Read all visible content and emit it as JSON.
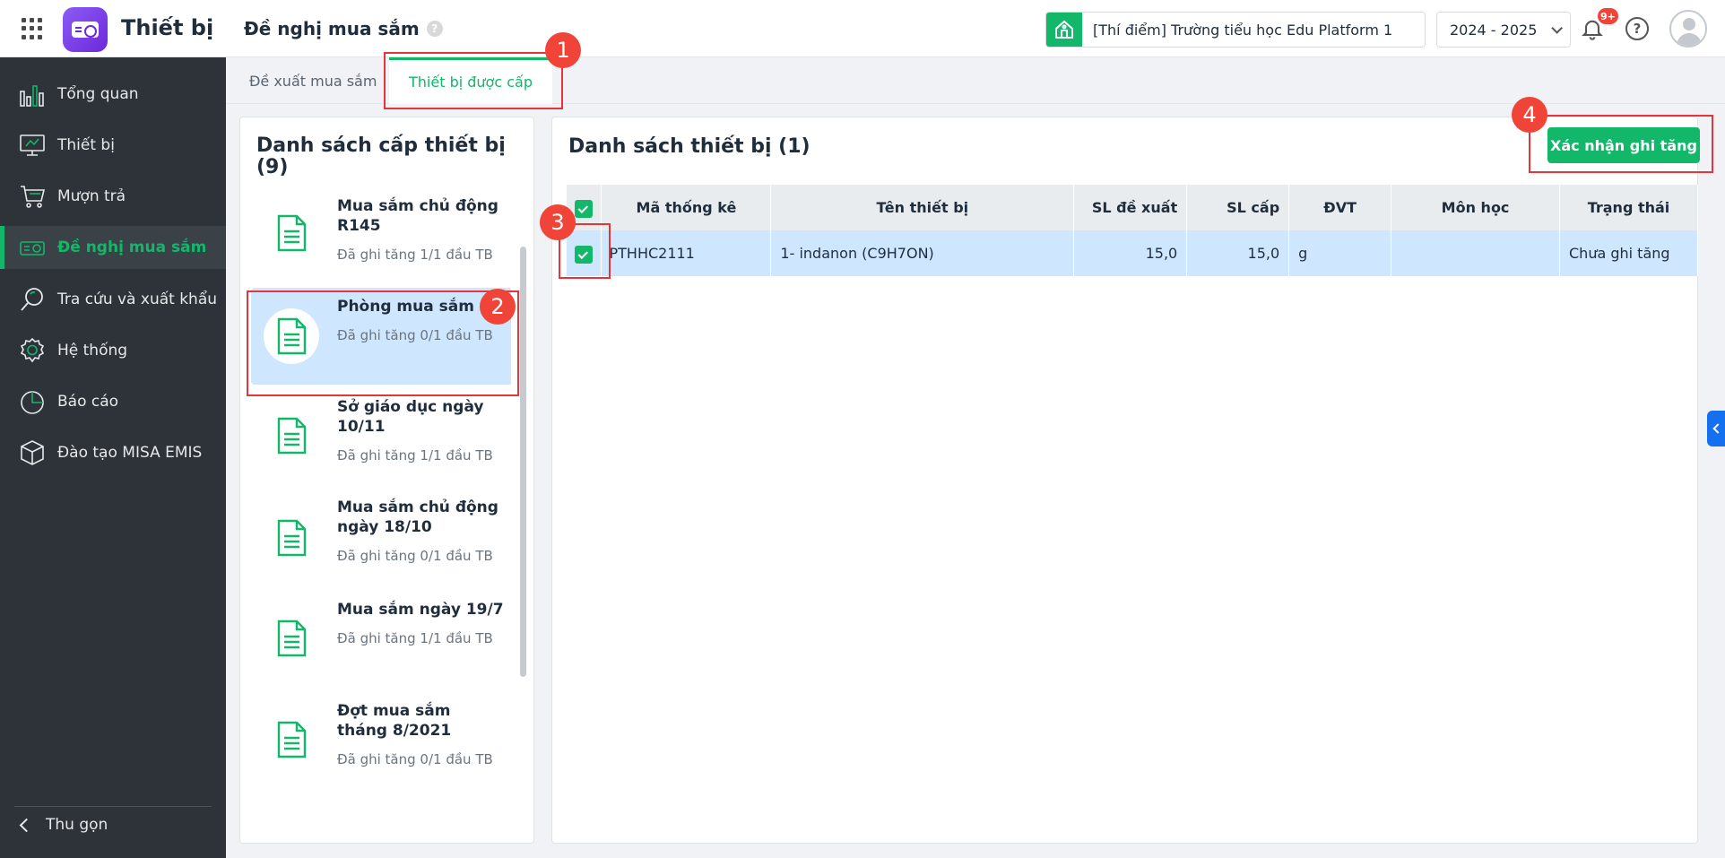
{
  "header": {
    "app_name": "Thiết bị",
    "page_title": "Đề nghị mua sắm",
    "help_badge": "?",
    "school": "[Thí điểm] Trường tiểu học Edu Platform 1",
    "year": "2024 - 2025",
    "notification_count": "9+",
    "help_icon": "?"
  },
  "sidebar": {
    "items": [
      {
        "label": "Tổng quan",
        "icon": "bar-chart-icon"
      },
      {
        "label": "Thiết bị",
        "icon": "monitor-icon"
      },
      {
        "label": "Mượn trả",
        "icon": "cart-icon"
      },
      {
        "label": "Đề nghị mua sắm",
        "icon": "projector-icon"
      },
      {
        "label": "Tra cứu và xuất khẩu",
        "icon": "search-icon"
      },
      {
        "label": "Hệ thống",
        "icon": "gear-icon"
      },
      {
        "label": "Báo cáo",
        "icon": "pie-chart-icon"
      },
      {
        "label": "Đào tạo MISA EMIS",
        "icon": "box-icon"
      }
    ],
    "active_index": 3,
    "collapse_label": "Thu gọn"
  },
  "tabs": [
    {
      "label": "Đề xuất mua sắm"
    },
    {
      "label": "Thiết bị được cấp"
    }
  ],
  "left_panel": {
    "title": "Danh sách cấp thiết bị (9)",
    "items": [
      {
        "name": "Mua sắm chủ động R145",
        "sub": "Đã ghi tăng 1/1 đầu TB"
      },
      {
        "name": "Phòng mua sắm",
        "sub": "Đã ghi tăng 0/1 đầu TB"
      },
      {
        "name": "Sở giáo dục ngày 10/11",
        "sub": "Đã ghi tăng 1/1 đầu TB"
      },
      {
        "name": "Mua sắm chủ động ngày 18/10",
        "sub": "Đã ghi tăng 0/1 đầu TB"
      },
      {
        "name": "Mua sắm ngày 19/7",
        "sub": "Đã ghi tăng 1/1 đầu TB"
      },
      {
        "name": "Đợt mua sắm tháng 8/2021",
        "sub": "Đã ghi tăng 0/1 đầu TB"
      }
    ]
  },
  "right_panel": {
    "title": "Danh sách thiết bị (1)",
    "confirm_button": "Xác nhận ghi tăng",
    "columns": [
      "Mã thống kê",
      "Tên thiết bị",
      "SL đề xuất",
      "SL cấp",
      "ĐVT",
      "Môn học",
      "Trạng thái"
    ],
    "rows": [
      [
        "PTHHC2111",
        "1- indanon (C9H7ON)",
        "15,0",
        "15,0",
        "g",
        "",
        "Chưa ghi tăng"
      ]
    ]
  },
  "callouts": [
    "1",
    "2",
    "3",
    "4"
  ],
  "colors": {
    "accent": "#12b76a",
    "sidebar_bg": "#2d3338",
    "selected_row": "#cfe6ff",
    "callout": "#f04438"
  }
}
